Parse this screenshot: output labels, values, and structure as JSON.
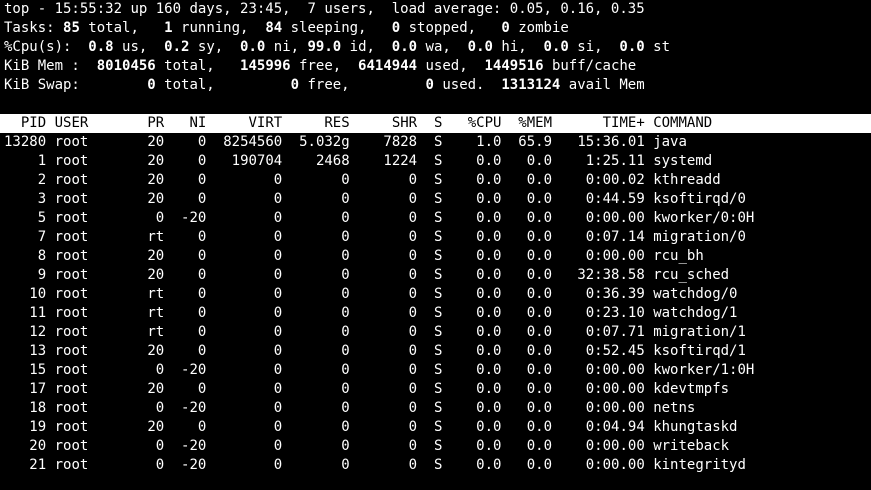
{
  "summary": {
    "top_line": {
      "prefix": "top - ",
      "time": "15:55:32",
      "uptime_text": " up 160 days, 23:45,  ",
      "users": "7",
      "users_label": " users,  load average: ",
      "load_avg": "0.05, 0.16, 0.35"
    },
    "tasks": {
      "label": "Tasks: ",
      "total": "85",
      "total_label": " total,   ",
      "running": "1",
      "running_label": " running,  ",
      "sleeping": "84",
      "sleeping_label": " sleeping,   ",
      "stopped": "0",
      "stopped_label": " stopped,   ",
      "zombie": "0",
      "zombie_label": " zombie"
    },
    "cpu": {
      "label": "%Cpu(s):  ",
      "us": "0.8",
      "us_label": " us,  ",
      "sy": "0.2",
      "sy_label": " sy,  ",
      "ni": "0.0",
      "ni_label": " ni, ",
      "id": "99.0",
      "id_label": " id,  ",
      "wa": "0.0",
      "wa_label": " wa,  ",
      "hi": "0.0",
      "hi_label": " hi,  ",
      "si": "0.0",
      "si_label": " si,  ",
      "st": "0.0",
      "st_label": " st"
    },
    "mem": {
      "label": "KiB Mem : ",
      "total": " 8010456",
      "total_label": " total,   ",
      "free": "145996",
      "free_label": " free,  ",
      "used": "6414944",
      "used_label": " used,  ",
      "buff": "1449516",
      "buff_label": " buff/cache"
    },
    "swap": {
      "label": "KiB Swap:        ",
      "total": "0",
      "total_label": " total,         ",
      "free": "0",
      "free_label": " free,         ",
      "used": "0",
      "used_label": " used.  ",
      "avail": "1313124",
      "avail_label": " avail Mem"
    }
  },
  "table": {
    "header": {
      "pid": "PID",
      "user": "USER",
      "pr": "PR",
      "ni": "NI",
      "virt": "VIRT",
      "res": "RES",
      "shr": "SHR",
      "s": "S",
      "cpu": "%CPU",
      "mem": "%MEM",
      "time": "TIME+",
      "command": "COMMAND"
    },
    "rows": [
      {
        "pid": "13280",
        "user": "root",
        "pr": "20",
        "ni": "0",
        "virt": "8254560",
        "res": "5.032g",
        "shr": "7828",
        "s": "S",
        "cpu": "1.0",
        "mem": "65.9",
        "time": "15:36.01",
        "command": "java"
      },
      {
        "pid": "1",
        "user": "root",
        "pr": "20",
        "ni": "0",
        "virt": "190704",
        "res": "2468",
        "shr": "1224",
        "s": "S",
        "cpu": "0.0",
        "mem": "0.0",
        "time": "1:25.11",
        "command": "systemd"
      },
      {
        "pid": "2",
        "user": "root",
        "pr": "20",
        "ni": "0",
        "virt": "0",
        "res": "0",
        "shr": "0",
        "s": "S",
        "cpu": "0.0",
        "mem": "0.0",
        "time": "0:00.02",
        "command": "kthreadd"
      },
      {
        "pid": "3",
        "user": "root",
        "pr": "20",
        "ni": "0",
        "virt": "0",
        "res": "0",
        "shr": "0",
        "s": "S",
        "cpu": "0.0",
        "mem": "0.0",
        "time": "0:44.59",
        "command": "ksoftirqd/0"
      },
      {
        "pid": "5",
        "user": "root",
        "pr": "0",
        "ni": "-20",
        "virt": "0",
        "res": "0",
        "shr": "0",
        "s": "S",
        "cpu": "0.0",
        "mem": "0.0",
        "time": "0:00.00",
        "command": "kworker/0:0H"
      },
      {
        "pid": "7",
        "user": "root",
        "pr": "rt",
        "ni": "0",
        "virt": "0",
        "res": "0",
        "shr": "0",
        "s": "S",
        "cpu": "0.0",
        "mem": "0.0",
        "time": "0:07.14",
        "command": "migration/0"
      },
      {
        "pid": "8",
        "user": "root",
        "pr": "20",
        "ni": "0",
        "virt": "0",
        "res": "0",
        "shr": "0",
        "s": "S",
        "cpu": "0.0",
        "mem": "0.0",
        "time": "0:00.00",
        "command": "rcu_bh"
      },
      {
        "pid": "9",
        "user": "root",
        "pr": "20",
        "ni": "0",
        "virt": "0",
        "res": "0",
        "shr": "0",
        "s": "S",
        "cpu": "0.0",
        "mem": "0.0",
        "time": "32:38.58",
        "command": "rcu_sched"
      },
      {
        "pid": "10",
        "user": "root",
        "pr": "rt",
        "ni": "0",
        "virt": "0",
        "res": "0",
        "shr": "0",
        "s": "S",
        "cpu": "0.0",
        "mem": "0.0",
        "time": "0:36.39",
        "command": "watchdog/0"
      },
      {
        "pid": "11",
        "user": "root",
        "pr": "rt",
        "ni": "0",
        "virt": "0",
        "res": "0",
        "shr": "0",
        "s": "S",
        "cpu": "0.0",
        "mem": "0.0",
        "time": "0:23.10",
        "command": "watchdog/1"
      },
      {
        "pid": "12",
        "user": "root",
        "pr": "rt",
        "ni": "0",
        "virt": "0",
        "res": "0",
        "shr": "0",
        "s": "S",
        "cpu": "0.0",
        "mem": "0.0",
        "time": "0:07.71",
        "command": "migration/1"
      },
      {
        "pid": "13",
        "user": "root",
        "pr": "20",
        "ni": "0",
        "virt": "0",
        "res": "0",
        "shr": "0",
        "s": "S",
        "cpu": "0.0",
        "mem": "0.0",
        "time": "0:52.45",
        "command": "ksoftirqd/1"
      },
      {
        "pid": "15",
        "user": "root",
        "pr": "0",
        "ni": "-20",
        "virt": "0",
        "res": "0",
        "shr": "0",
        "s": "S",
        "cpu": "0.0",
        "mem": "0.0",
        "time": "0:00.00",
        "command": "kworker/1:0H"
      },
      {
        "pid": "17",
        "user": "root",
        "pr": "20",
        "ni": "0",
        "virt": "0",
        "res": "0",
        "shr": "0",
        "s": "S",
        "cpu": "0.0",
        "mem": "0.0",
        "time": "0:00.00",
        "command": "kdevtmpfs"
      },
      {
        "pid": "18",
        "user": "root",
        "pr": "0",
        "ni": "-20",
        "virt": "0",
        "res": "0",
        "shr": "0",
        "s": "S",
        "cpu": "0.0",
        "mem": "0.0",
        "time": "0:00.00",
        "command": "netns"
      },
      {
        "pid": "19",
        "user": "root",
        "pr": "20",
        "ni": "0",
        "virt": "0",
        "res": "0",
        "shr": "0",
        "s": "S",
        "cpu": "0.0",
        "mem": "0.0",
        "time": "0:04.94",
        "command": "khungtaskd"
      },
      {
        "pid": "20",
        "user": "root",
        "pr": "0",
        "ni": "-20",
        "virt": "0",
        "res": "0",
        "shr": "0",
        "s": "S",
        "cpu": "0.0",
        "mem": "0.0",
        "time": "0:00.00",
        "command": "writeback"
      },
      {
        "pid": "21",
        "user": "root",
        "pr": "0",
        "ni": "-20",
        "virt": "0",
        "res": "0",
        "shr": "0",
        "s": "S",
        "cpu": "0.0",
        "mem": "0.0",
        "time": "0:00.00",
        "command": "kintegrityd"
      }
    ]
  },
  "colors": {
    "background": "#000000",
    "foreground": "#ffffff",
    "header_bg": "#ffffff",
    "header_fg": "#000000"
  }
}
